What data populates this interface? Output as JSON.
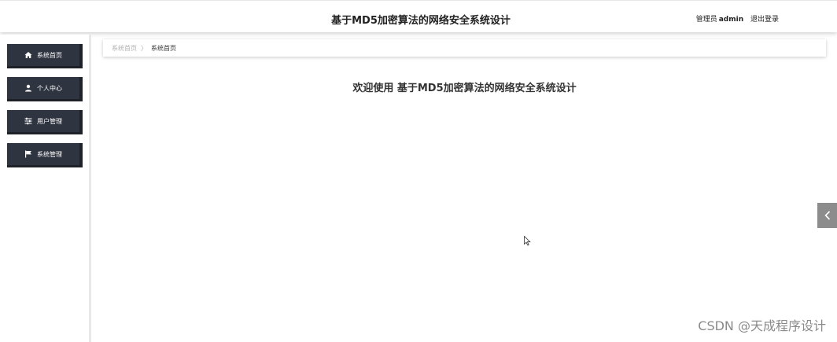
{
  "header": {
    "title": "基于MD5加密算法的网络安全系统设计",
    "role": "管理员",
    "username": "admin",
    "logout_label": "退出登录"
  },
  "sidebar": {
    "items": [
      {
        "label": "系统首页",
        "icon": "home-icon"
      },
      {
        "label": "个人中心",
        "icon": "user-icon"
      },
      {
        "label": "用户管理",
        "icon": "sliders-icon"
      },
      {
        "label": "系统管理",
        "icon": "flag-icon"
      }
    ]
  },
  "breadcrumb": {
    "home": "系统首页",
    "separator": "〉",
    "current": "系统首页"
  },
  "main": {
    "welcome": "欢迎使用 基于MD5加密算法的网络安全系统设计"
  },
  "watermark": "CSDN @天成程序设计",
  "colors": {
    "sidebar_button": "#2e3440",
    "side_tab": "#8c8c8c"
  }
}
